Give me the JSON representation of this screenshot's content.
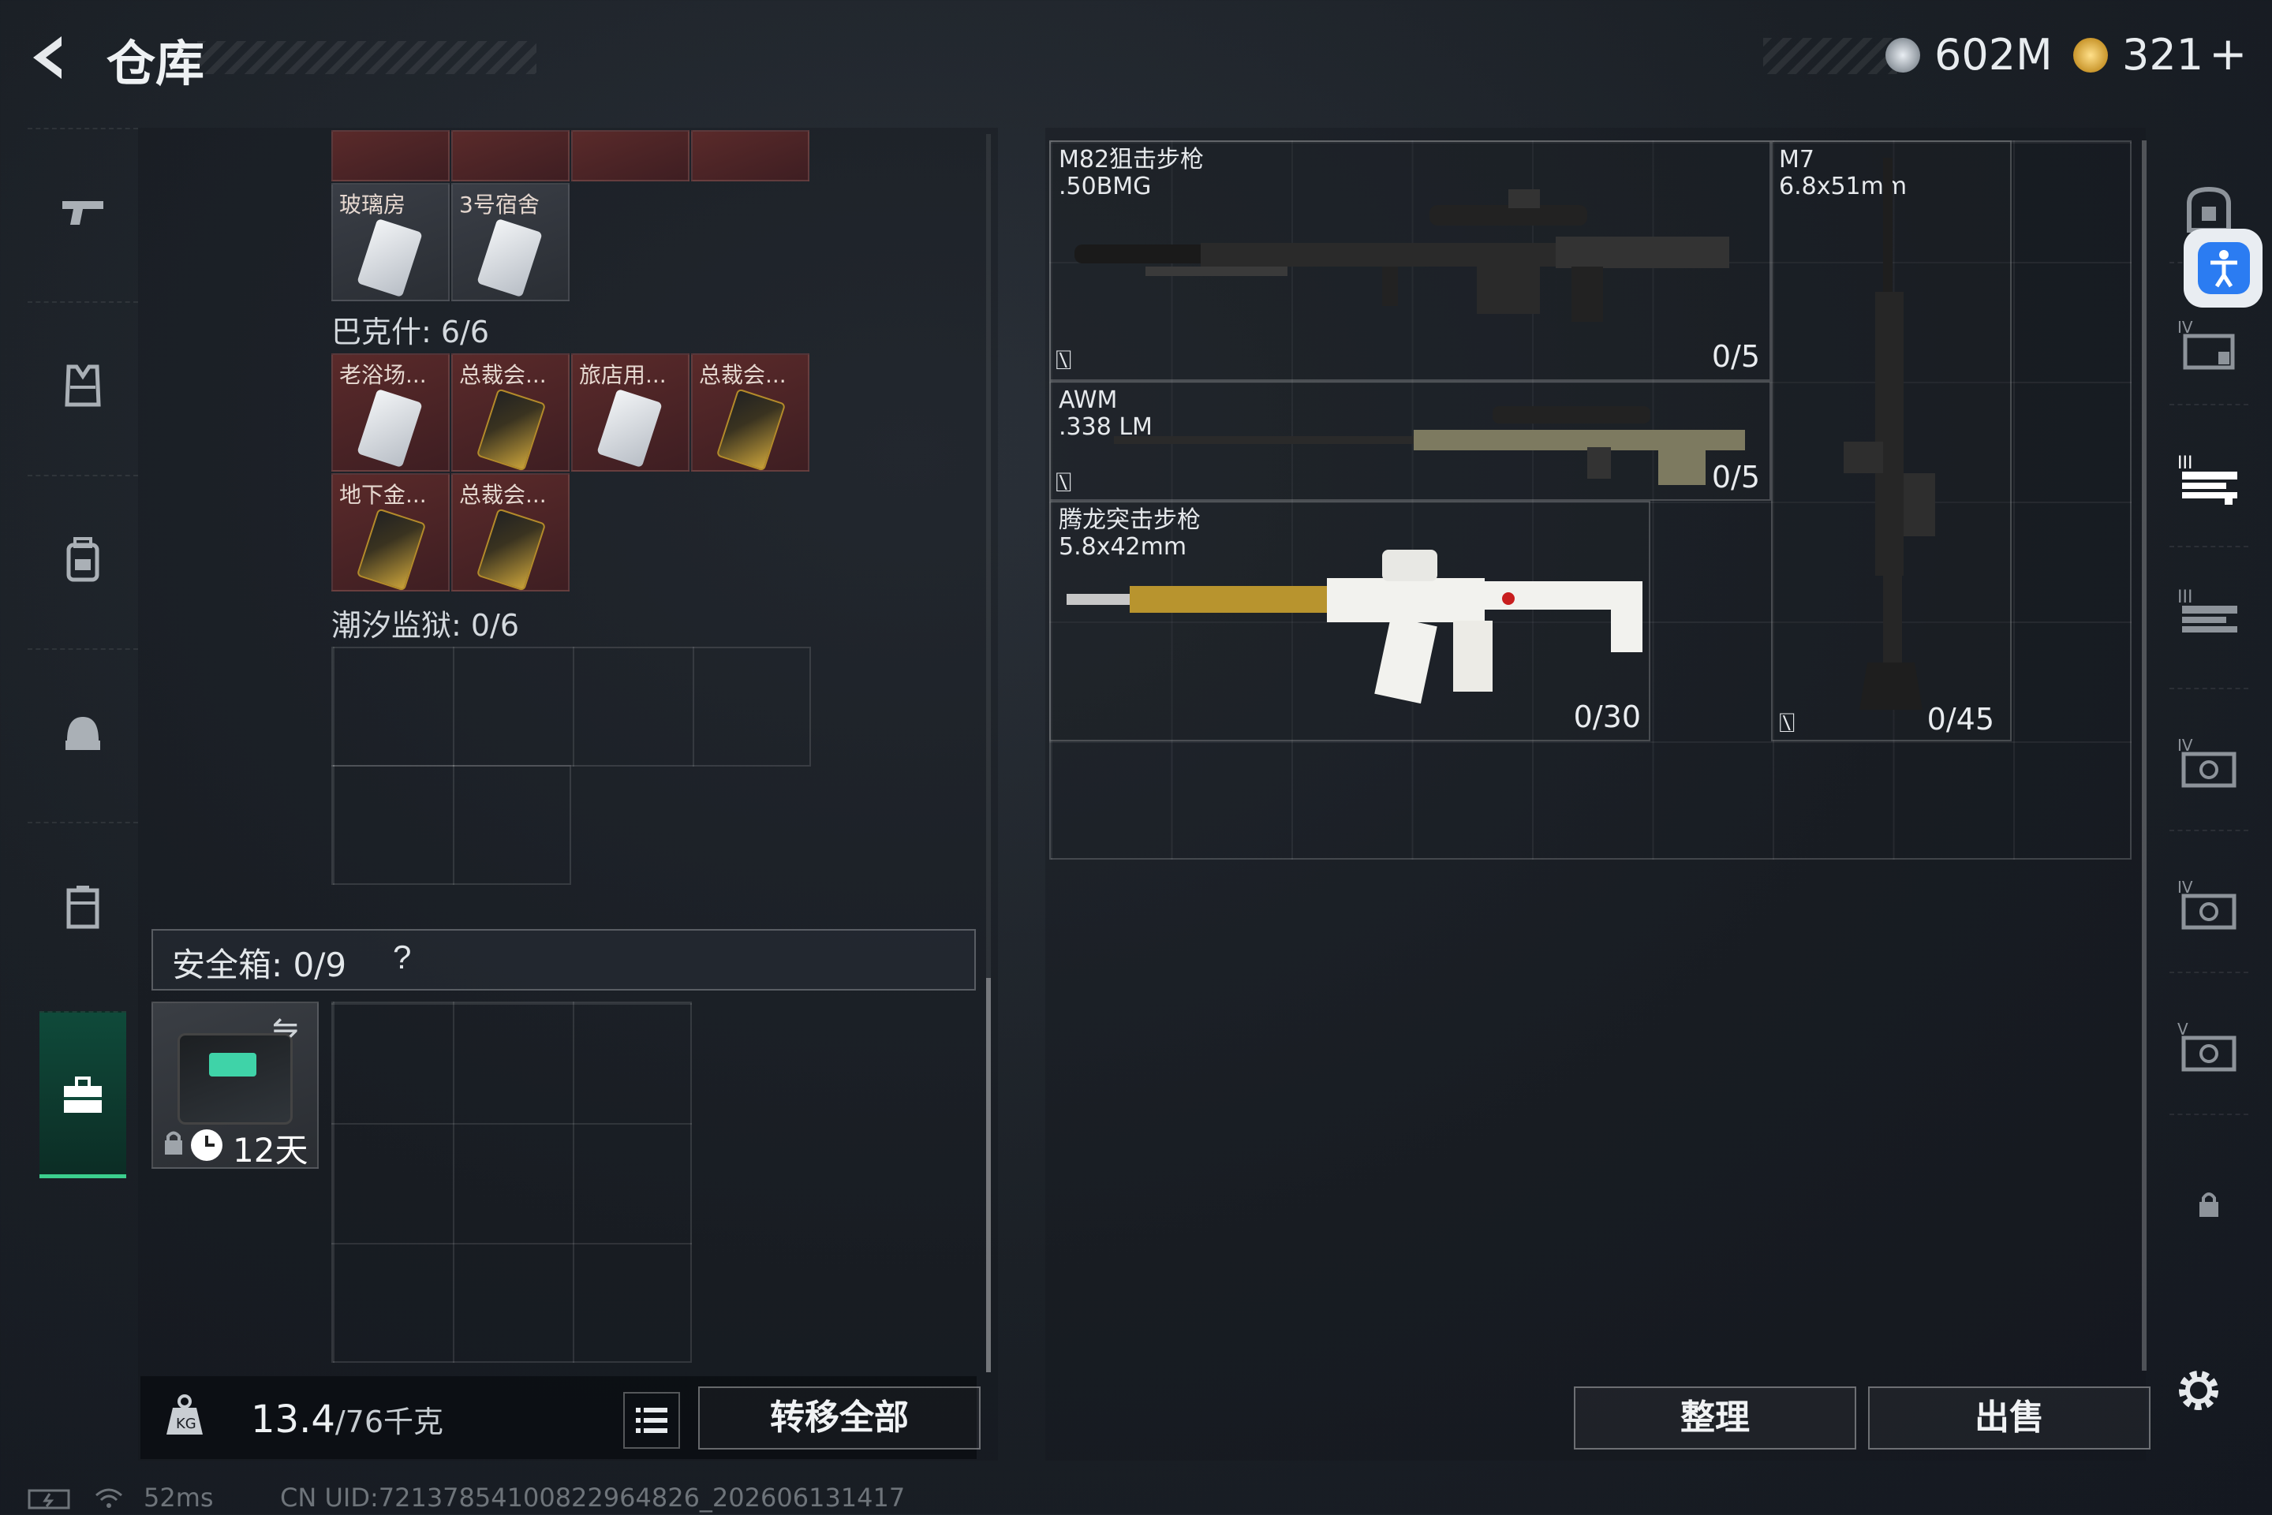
{
  "header": {
    "back_icon": "back-arrow-icon",
    "title": "仓库",
    "currency1": {
      "icon": "silver-coin-icon",
      "value": "602M"
    },
    "currency2": {
      "icon": "gold-coin-icon",
      "value": "321",
      "plus": "+"
    }
  },
  "left_nav": [
    {
      "icon": "pistol-icon",
      "selected": false
    },
    {
      "icon": "armor-vest-icon",
      "selected": false
    },
    {
      "icon": "backpack-icon",
      "selected": false
    },
    {
      "icon": "helmet-icon",
      "selected": false
    },
    {
      "icon": "locker-icon",
      "selected": false
    },
    {
      "icon": "briefcase-icon",
      "selected": true
    }
  ],
  "storage": {
    "top_row_items": [
      "",
      "",
      "",
      ""
    ],
    "group1_items": [
      {
        "label": "玻璃房",
        "card": "white"
      },
      {
        "label": "3号宿舍",
        "card": "white"
      }
    ],
    "group2": {
      "title": "巴克什: 6/6",
      "items": [
        {
          "label": "老浴场...",
          "card": "white"
        },
        {
          "label": "总裁会...",
          "card": "gold"
        },
        {
          "label": "旅店用...",
          "card": "white"
        },
        {
          "label": "总裁会...",
          "card": "gold"
        },
        {
          "label": "地下金...",
          "card": "gold"
        },
        {
          "label": "总裁会...",
          "card": "gold"
        }
      ]
    },
    "group3": {
      "title": "潮汐监狱: 0/6"
    }
  },
  "safe": {
    "title": "安全箱:",
    "count": "0/9",
    "help": "?",
    "time_left": "12天",
    "swap_icon": "swap-icon",
    "lock_icon": "lock-icon",
    "clock_icon": "clock-icon"
  },
  "bottom_left": {
    "weight_icon": "weight-kg-icon",
    "weight": "13.4",
    "capacity": "/76千克",
    "list_icon": "list-icon",
    "transfer_all": "转移全部"
  },
  "weapons": [
    {
      "name": "M82狙击步枪\n.50BMG",
      "ammo": "0/5"
    },
    {
      "name": "AWM\n.338 LM",
      "ammo": "0/5"
    },
    {
      "name": "腾龙突击步枪\n5.8x42mm",
      "ammo": "0/30"
    },
    {
      "name": "M7\n6.8x51mm",
      "ammo": "0/45"
    }
  ],
  "right_nav": [
    {
      "icon": "safe-container-icon",
      "tier": ""
    },
    {
      "icon": "storage-case-icon",
      "tier": "IV"
    },
    {
      "icon": "weapon-rack-icon",
      "tier": "III"
    },
    {
      "icon": "weapon-rack-icon",
      "tier": "III"
    },
    {
      "icon": "ammo-box-icon",
      "tier": "IV"
    },
    {
      "icon": "ammo-box-icon",
      "tier": "IV"
    },
    {
      "icon": "ammo-box-icon",
      "tier": "V"
    },
    {
      "icon": "lock-icon",
      "tier": ""
    }
  ],
  "bottom_right": {
    "sort": "整理",
    "sell": "出售",
    "settings_icon": "gear-icon"
  },
  "status_bar": {
    "battery_icon": "battery-icon",
    "wifi_icon": "wifi-icon",
    "ping": "52ms",
    "uid": "CN UID:7213785410082296​4826_202606131417"
  },
  "colors": {
    "selected_nav": "#3ccf8e",
    "item_bg": "#5a2a2a",
    "accessibility": "#2b7cf2"
  }
}
